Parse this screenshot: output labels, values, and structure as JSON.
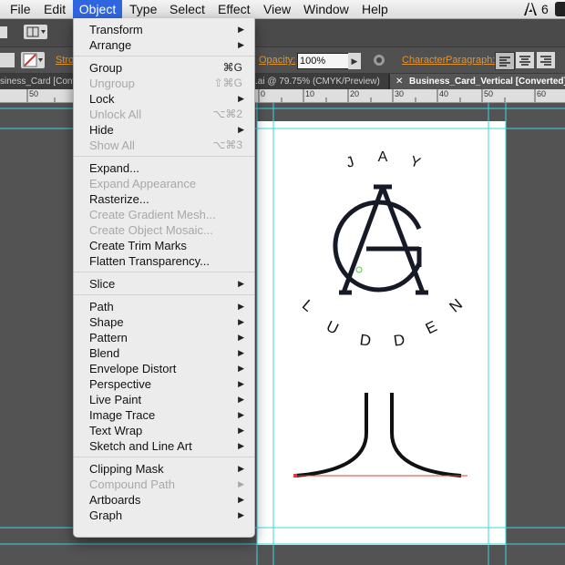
{
  "menubar": {
    "items": [
      "File",
      "Edit",
      "Object",
      "Type",
      "Select",
      "Effect",
      "View",
      "Window",
      "Help"
    ],
    "right_text": "6"
  },
  "control_bar": {
    "stroke_label": "Stro",
    "opacity_label": "Opacity:",
    "opacity_value": "100%",
    "character_label": "Character",
    "paragraph_label": "Paragraph:"
  },
  "tabs": {
    "left": "siness_Card [Convert",
    "middle": ".ai @ 79.75% (CMYK/Preview)",
    "active": "Business_Card_Vertical [Converted].a"
  },
  "ruler": {
    "labels": [
      "50",
      "0",
      "10",
      "20",
      "30",
      "40",
      "50",
      "60"
    ]
  },
  "menu": {
    "items": [
      {
        "label": "Transform",
        "submenu": true
      },
      {
        "label": "Arrange",
        "submenu": true
      },
      {
        "sep": true
      },
      {
        "label": "Group",
        "shortcut": "⌘G"
      },
      {
        "label": "Ungroup",
        "shortcut": "⇧⌘G",
        "disabled": true
      },
      {
        "label": "Lock",
        "submenu": true
      },
      {
        "label": "Unlock All",
        "shortcut": "⌥⌘2",
        "disabled": true
      },
      {
        "label": "Hide",
        "submenu": true
      },
      {
        "label": "Show All",
        "shortcut": "⌥⌘3",
        "disabled": true
      },
      {
        "sep": true
      },
      {
        "label": "Expand..."
      },
      {
        "label": "Expand Appearance",
        "disabled": true
      },
      {
        "label": "Rasterize..."
      },
      {
        "label": "Create Gradient Mesh...",
        "disabled": true
      },
      {
        "label": "Create Object Mosaic...",
        "disabled": true
      },
      {
        "label": "Create Trim Marks"
      },
      {
        "label": "Flatten Transparency..."
      },
      {
        "sep": true
      },
      {
        "label": "Slice",
        "submenu": true
      },
      {
        "sep": true
      },
      {
        "label": "Path",
        "submenu": true
      },
      {
        "label": "Shape",
        "submenu": true
      },
      {
        "label": "Pattern",
        "submenu": true
      },
      {
        "label": "Blend",
        "submenu": true
      },
      {
        "label": "Envelope Distort",
        "submenu": true
      },
      {
        "label": "Perspective",
        "submenu": true
      },
      {
        "label": "Live Paint",
        "submenu": true
      },
      {
        "label": "Image Trace",
        "submenu": true
      },
      {
        "label": "Text Wrap",
        "submenu": true
      },
      {
        "label": "Sketch and Line Art",
        "submenu": true
      },
      {
        "sep": true
      },
      {
        "label": "Clipping Mask",
        "submenu": true
      },
      {
        "label": "Compound Path",
        "submenu": true,
        "disabled": true
      },
      {
        "label": "Artboards",
        "submenu": true
      },
      {
        "label": "Graph",
        "submenu": true
      }
    ]
  },
  "artwork": {
    "top_letters": [
      "J",
      "A",
      "Y"
    ],
    "bottom_letters": [
      "L",
      "U",
      "D",
      "D",
      "E",
      "N"
    ],
    "colors": {
      "guide": "#3ad7e6",
      "logo": "#151a26",
      "selection": "#e03a3a",
      "accent": "#2f66e0"
    }
  }
}
